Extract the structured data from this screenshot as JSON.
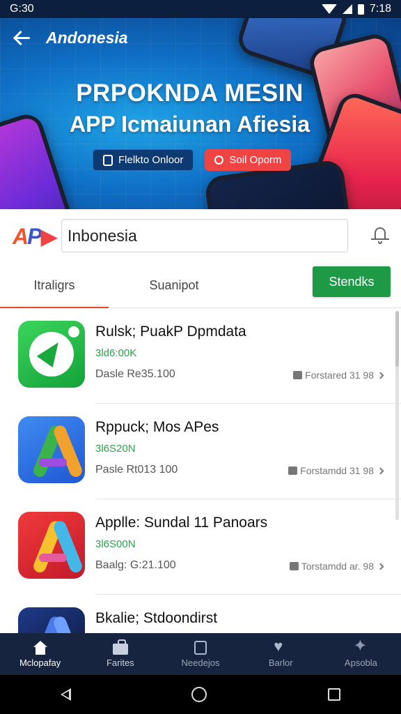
{
  "status_bar": {
    "time_left": "G:30",
    "time_right": "7:18"
  },
  "hero": {
    "title": "Andonesia",
    "headline_1": "PRPOKNDA MESIN",
    "headline_2": "APP Icmaiunan Afiesia",
    "button_1": "Flelkto Onloor",
    "button_2": "Soil Oporm"
  },
  "search": {
    "logo_text": "AP",
    "value": "Inbonesia"
  },
  "tabs": [
    {
      "label": "Itraligrs"
    },
    {
      "label": "Suanipot"
    }
  ],
  "green_button": "Stendks",
  "apps": [
    {
      "title": "Rulsk; PuakP Dpmdata",
      "size": "3ld6:00K",
      "price": "Dasle Re35.100",
      "meta": "Forstared 31 98"
    },
    {
      "title": "Rppuck; Mos APes",
      "size": "3l6S20N",
      "price": "Pasle Rt013 100",
      "meta": "Forstamdd 31 98"
    },
    {
      "title": "Applle: Sundal 11 Panoars",
      "size": "3l6S00N",
      "price": "Baalg: G:21.100",
      "meta": "Torstamdd ar. 98"
    },
    {
      "title": "Bkalie; Stdoondirst",
      "size": "",
      "price": "",
      "meta": ""
    }
  ],
  "bottom_nav": [
    {
      "label": "Mclopafay"
    },
    {
      "label": "Farites"
    },
    {
      "label": "Needejos"
    },
    {
      "label": "Barlor"
    },
    {
      "label": "Apsobla"
    }
  ],
  "colors": {
    "accent_red": "#e8442c",
    "green_button": "#1e9a46",
    "size_green": "#2aa34a",
    "nav_bg": "#16243f"
  },
  "icons": [
    "back-arrow-icon",
    "bell-icon",
    "home-icon",
    "features-icon",
    "news-icon",
    "heart-icon",
    "apps-icon"
  ]
}
